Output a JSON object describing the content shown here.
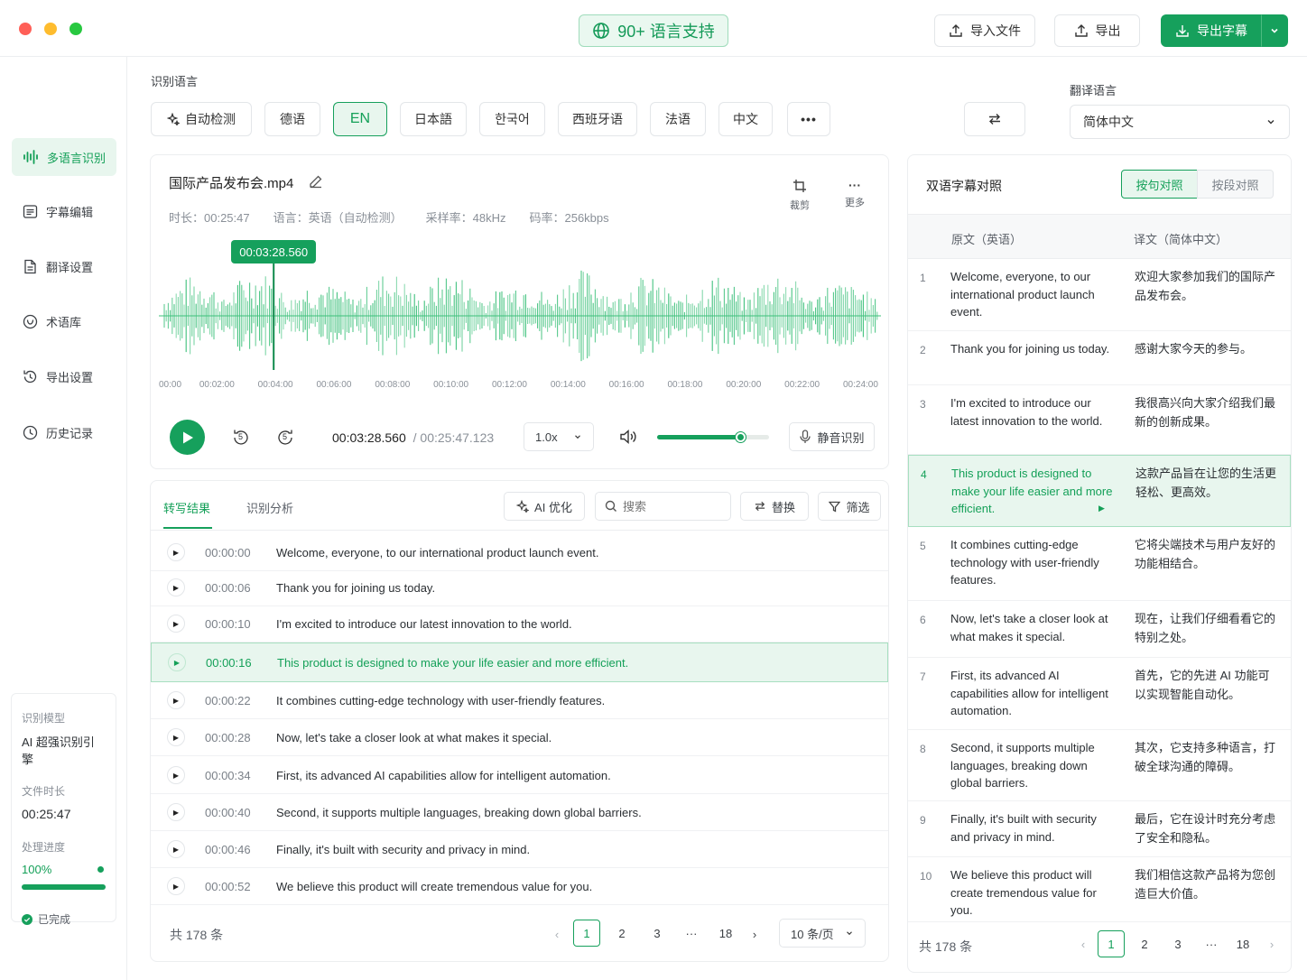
{
  "header": {
    "lang_badge": "90+ 语言支持",
    "import_label": "导入文件",
    "export_label": "导出",
    "export_subs_label": "导出字幕"
  },
  "sidebar": {
    "items": [
      {
        "label": "多语言识别",
        "icon": "waveform-icon"
      },
      {
        "label": "字幕编辑",
        "icon": "subtitle-icon"
      },
      {
        "label": "翻译设置",
        "icon": "document-icon"
      },
      {
        "label": "术语库",
        "icon": "glossary-icon"
      },
      {
        "label": "导出设置",
        "icon": "export-settings-icon"
      },
      {
        "label": "历史记录",
        "icon": "clock-icon"
      }
    ],
    "info": {
      "model_label": "识别模型",
      "model_value": "AI 超强识别引擎",
      "duration_label": "文件时长",
      "duration_value": "00:25:47",
      "progress_label": "处理进度",
      "progress_value": "100%",
      "progress_fraction": 1.0,
      "status": "已完成"
    }
  },
  "recognition": {
    "label": "识别语言",
    "languages": [
      "自动检测",
      "德语",
      "EN",
      "日本語",
      "한국어",
      "西班牙语",
      "法语",
      "中文"
    ],
    "more": "•••",
    "translate_label": "翻译语言",
    "translate_value": "简体中文"
  },
  "media": {
    "filename": "国际产品发布会.mp4",
    "meta": [
      "时长：00:25:47",
      "语言：英语（自动检测）",
      "采样率：48kHz",
      "码率：256kbps"
    ],
    "crop_label": "裁剪",
    "more_label": "更多",
    "playhead": "00:03:28.560",
    "playhead_fraction": 0.159,
    "axis_ticks": [
      "00:00",
      "00:02:00",
      "00:04:00",
      "00:06:00",
      "00:08:00",
      "00:10:00",
      "00:12:00",
      "00:14:00",
      "00:16:00",
      "00:18:00",
      "00:20:00",
      "00:22:00",
      "00:24:00"
    ],
    "current_time": "00:03:28.560",
    "total_time": "/ 00:25:47.123",
    "speed": "1.0x",
    "volume_fraction": 0.75,
    "silence_label": "静音识别",
    "rewind_label": "5",
    "forward_label": "5"
  },
  "transcript": {
    "tabs": [
      "转写结果",
      "识别分析"
    ],
    "ai_label": "AI 优化",
    "search_placeholder": "搜索",
    "replace_label": "替换",
    "filter_label": "筛选",
    "rows": [
      {
        "time": "00:00:00",
        "text": "Welcome, everyone, to our international product launch event."
      },
      {
        "time": "00:00:06",
        "text": "Thank you for joining us today."
      },
      {
        "time": "00:00:10",
        "text": "I'm excited to introduce our latest innovation to the world."
      },
      {
        "time": "00:00:16",
        "text": "This product is designed to make your life easier and more efficient."
      },
      {
        "time": "00:00:22",
        "text": "It combines cutting-edge technology with user-friendly features."
      },
      {
        "time": "00:00:28",
        "text": "Now, let's take a closer look at what makes it special."
      },
      {
        "time": "00:00:34",
        "text": "First, its advanced AI capabilities allow for intelligent automation."
      },
      {
        "time": "00:00:40",
        "text": "Second, it supports multiple languages, breaking down global barriers."
      },
      {
        "time": "00:00:46",
        "text": "Finally, it's built with security and privacy in mind."
      },
      {
        "time": "00:00:52",
        "text": "We believe this product will create tremendous value for you."
      }
    ],
    "total": "共 178 条",
    "pages": [
      "1",
      "2",
      "3",
      "···",
      "18"
    ],
    "page_size": "10 条/页"
  },
  "bilingual": {
    "title": "双语字幕对照",
    "mode_sentence": "按句对照",
    "mode_paragraph": "按段对照",
    "col_src": "原文（英语）",
    "col_dst": "译文（简体中文）",
    "rows": [
      {
        "num": "1",
        "src": "Welcome, everyone, to our international product launch event.",
        "dst": "欢迎大家参加我们的国际产品发布会。"
      },
      {
        "num": "2",
        "src": "Thank you for joining us today.",
        "dst": "感谢大家今天的参与。"
      },
      {
        "num": "3",
        "src": "I'm excited to introduce our latest innovation to the world.",
        "dst": "我很高兴向大家介绍我们最新的创新成果。"
      },
      {
        "num": "4",
        "src": "This product is designed to make your life easier and more efficient.",
        "dst": "这款产品旨在让您的生活更轻松、更高效。"
      },
      {
        "num": "5",
        "src": "It combines cutting-edge technology with user-friendly features.",
        "dst": "它将尖端技术与用户友好的功能相结合。"
      },
      {
        "num": "6",
        "src": "Now, let's take a closer look at what makes it special.",
        "dst": "现在，让我们仔细看看它的特别之处。"
      },
      {
        "num": "7",
        "src": "First, its advanced AI capabilities allow for intelligent automation.",
        "dst": "首先，它的先进 AI 功能可以实现智能自动化。"
      },
      {
        "num": "8",
        "src": "Second, it supports multiple languages, breaking down global barriers.",
        "dst": "其次，它支持多种语言，打破全球沟通的障碍。"
      },
      {
        "num": "9",
        "src": "Finally, it's built with security and privacy in mind.",
        "dst": "最后，它在设计时充分考虑了安全和隐私。"
      },
      {
        "num": "10",
        "src": "We believe this product will create tremendous value for you.",
        "dst": "我们相信这款产品将为您创造巨大价值。"
      }
    ],
    "total": "共 178 条",
    "pages": [
      "1",
      "2",
      "3",
      "···",
      "18"
    ]
  },
  "colors": {
    "accent": "#16a05c",
    "accent_light": "#e8f6ee",
    "wave": "#3cc07a"
  }
}
